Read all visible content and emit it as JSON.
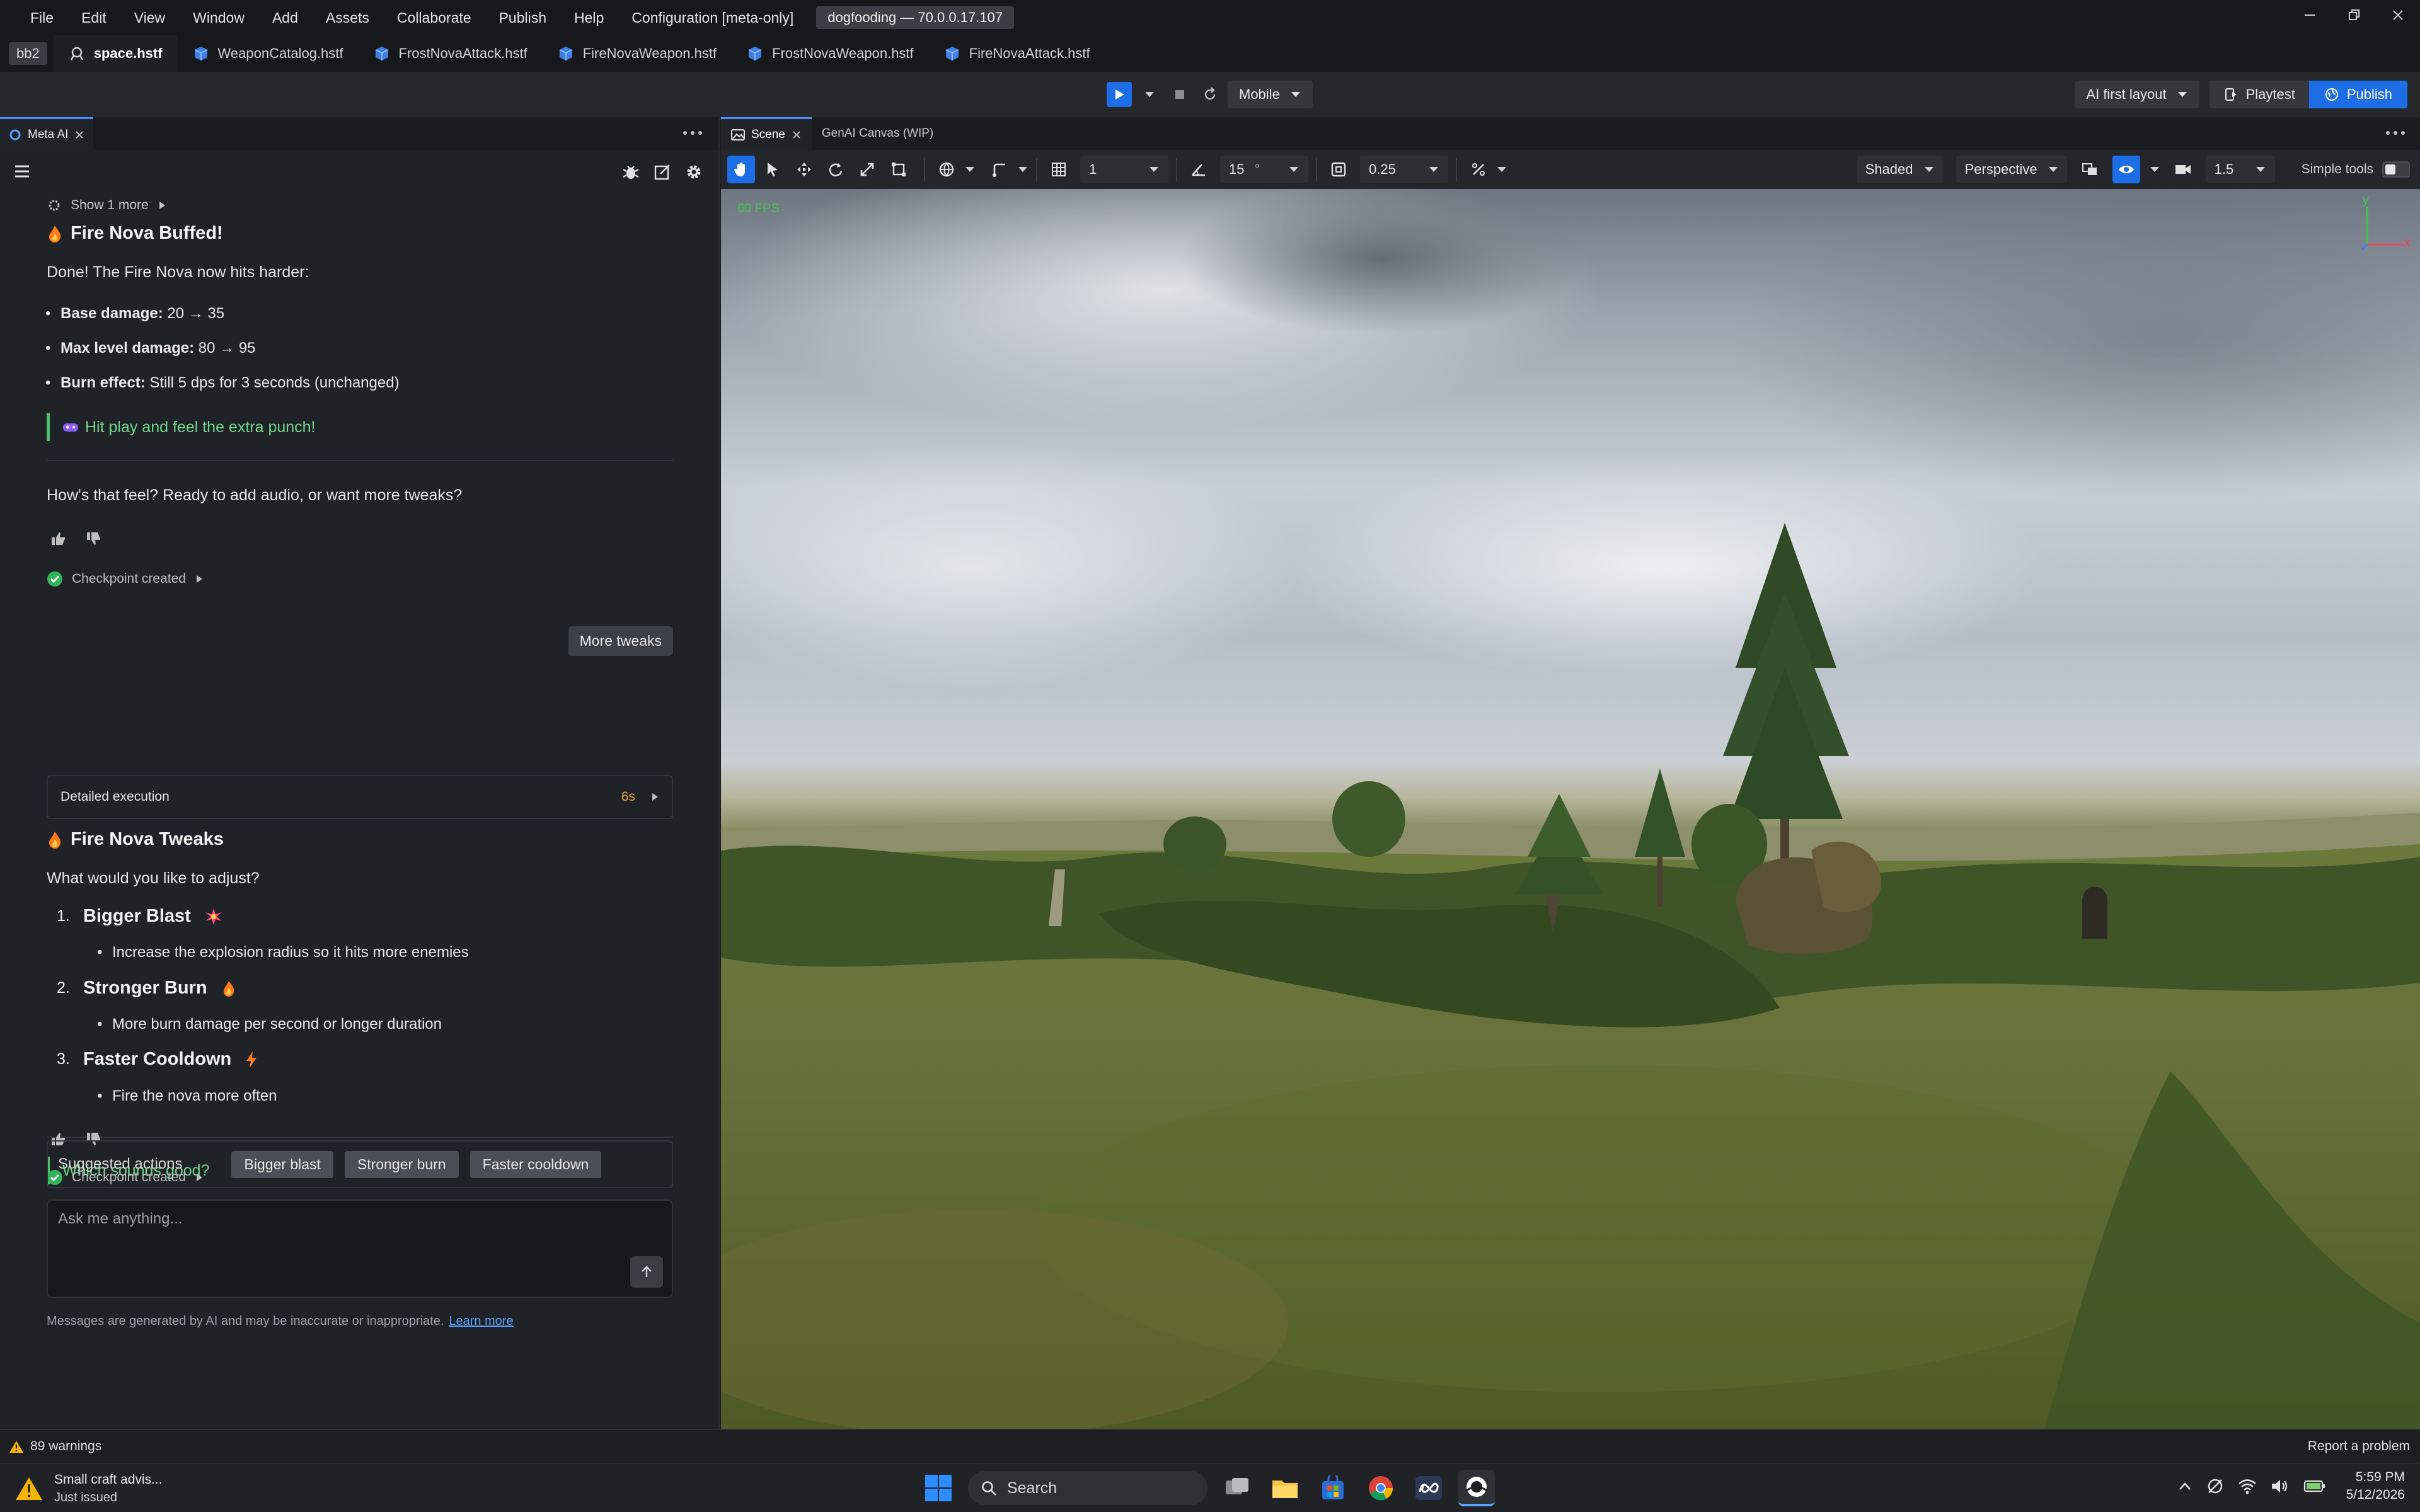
{
  "menubar": {
    "items": [
      "File",
      "Edit",
      "View",
      "Window",
      "Add",
      "Assets",
      "Collaborate",
      "Publish",
      "Help",
      "Configuration [meta-only]"
    ],
    "build_badge": "dogfooding — 70.0.0.17.107"
  },
  "filetabs": {
    "workspace_badge": "bb2",
    "tabs": [
      "space.hstf",
      "WeaponCatalog.hstf",
      "FrostNovaAttack.hstf",
      "FireNovaWeapon.hstf",
      "FrostNovaWeapon.hstf",
      "FireNovaAttack.hstf"
    ]
  },
  "playbar": {
    "platform": "Mobile",
    "layout": "AI first layout",
    "playtest": "Playtest",
    "publish": "Publish",
    "colors": {
      "accent": "#1d6ee6"
    }
  },
  "leftpanel": {
    "tab_label": "Meta AI",
    "show_more": "Show 1 more",
    "msg1": {
      "title": "Fire Nova Buffed!",
      "intro": "Done! The Fire Nova now hits harder:",
      "bullets": [
        {
          "label": "Base damage:",
          "value": "20 → 35"
        },
        {
          "label": "Max level damage:",
          "value": "80 → 95"
        },
        {
          "label": "Burn effect:",
          "value": "Still 5 dps for 3 seconds (unchanged)"
        }
      ],
      "quote": "Hit play and feel the extra punch!",
      "question": "How's that feel? Ready to add audio, or want more tweaks?",
      "checkpoint": "Checkpoint created"
    },
    "user_reply": "More tweaks",
    "exec": {
      "label": "Detailed execution",
      "time": "6s"
    },
    "msg2": {
      "title": "Fire Nova Tweaks",
      "intro": "What would you like to adjust?",
      "items": [
        {
          "num": "1.",
          "title": "Bigger Blast",
          "detail": "Increase the explosion radius so it hits more enemies"
        },
        {
          "num": "2.",
          "title": "Stronger Burn",
          "detail": "More burn damage per second or longer duration"
        },
        {
          "num": "3.",
          "title": "Faster Cooldown",
          "detail": "Fire the nova more often"
        }
      ],
      "quote": "Which sounds good?",
      "checkpoint": "Checkpoint created"
    },
    "suggested": {
      "label": "Suggested actions",
      "actions": [
        "Bigger blast",
        "Stronger burn",
        "Faster cooldown"
      ]
    },
    "composer": {
      "placeholder": "Ask me anything..."
    },
    "disclaimer": "Messages are generated by AI and may be inaccurate or inappropriate.",
    "learn_more": "Learn more"
  },
  "scene": {
    "tabs": [
      "Scene",
      "GenAI Canvas (WIP)"
    ],
    "grid_value": "1",
    "angle_value": "15",
    "angle_unit": "°",
    "scale_value": "0.25",
    "shading": "Shaded",
    "projection": "Perspective",
    "camera_speed": "1.5",
    "simple_tools": "Simple tools",
    "fps": "60 FPS",
    "axes": {
      "y": "y",
      "x": "x"
    }
  },
  "statusbar": {
    "warnings": "89 warnings",
    "report": "Report a problem"
  },
  "taskbar": {
    "notification_title": "Small craft advis...",
    "notification_sub": "Just issued",
    "search": "Search",
    "time": "5:59 PM",
    "date": "5/12/2026"
  }
}
